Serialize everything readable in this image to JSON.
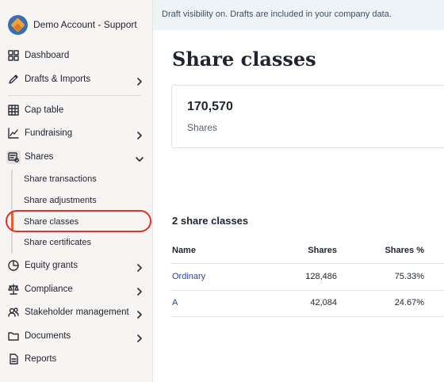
{
  "sidebar": {
    "account_name": "Demo Account - Support",
    "items": [
      {
        "label": "Dashboard",
        "icon": "grid-icon"
      },
      {
        "label": "Drafts & Imports",
        "icon": "pencil-icon"
      },
      {
        "label": "Cap table",
        "icon": "table-icon"
      },
      {
        "label": "Fundraising",
        "icon": "chart-icon"
      },
      {
        "label": "Shares",
        "icon": "shares-icon"
      },
      {
        "label": "Equity grants",
        "icon": "pie-icon"
      },
      {
        "label": "Compliance",
        "icon": "scales-icon"
      },
      {
        "label": "Stakeholder management",
        "icon": "people-icon"
      },
      {
        "label": "Documents",
        "icon": "folder-icon"
      },
      {
        "label": "Reports",
        "icon": "document-icon"
      }
    ],
    "shares_sub": [
      {
        "label": "Share transactions"
      },
      {
        "label": "Share adjustments"
      },
      {
        "label": "Share classes"
      },
      {
        "label": "Share certificates"
      }
    ]
  },
  "banner": {
    "text": "Draft visibility on. Drafts are included in your company data."
  },
  "main": {
    "title": "Share classes",
    "stat": {
      "value": "170,570",
      "label": "Shares"
    },
    "section_title": "2 share classes",
    "table": {
      "headers": [
        "Name",
        "Shares",
        "Shares %"
      ],
      "rows": [
        [
          "Ordinary",
          "128,486",
          "75.33%"
        ],
        [
          "A",
          "42,084",
          "24.67%"
        ]
      ]
    }
  },
  "colors": {
    "accent": "#e8622c",
    "highlight_ring": "#d9342b",
    "link": "#2b4a9b",
    "banner_bg": "#eef3f8"
  }
}
